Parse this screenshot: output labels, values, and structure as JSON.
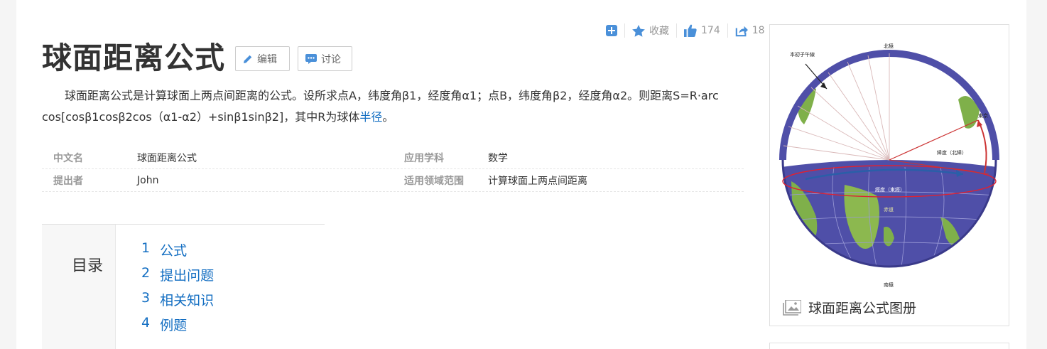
{
  "actions": {
    "add_icon": "plus-square-icon",
    "favorite_label": "收藏",
    "like_count": "174",
    "share_count": "18"
  },
  "title": "球面距离公式",
  "buttons": {
    "edit": "编辑",
    "discuss": "讨论"
  },
  "summary": {
    "text_before": "球面距离公式是计算球面上两点间距离的公式。设所求点A，纬度角β1，经度角α1；点B，纬度角β2，经度角α2。则距离S=R·arc cos[cosβ1cosβ2cos（α1-α2）+sinβ1sinβ2]，其中R为球体",
    "link": "半径",
    "text_after": "。"
  },
  "basic_info": [
    {
      "k1": "中文名",
      "v1": "球面距离公式",
      "k2": "应用学科",
      "v2": "数学"
    },
    {
      "k1": "提出者",
      "v1": "John",
      "k2": "适用领域范围",
      "v2": "计算球面上两点间距离"
    }
  ],
  "toc": {
    "heading": "目录",
    "items": [
      {
        "num": "1",
        "label": "公式"
      },
      {
        "num": "2",
        "label": "提出问题"
      },
      {
        "num": "3",
        "label": "相关知识"
      },
      {
        "num": "4",
        "label": "例题"
      }
    ]
  },
  "album": {
    "caption": "球面距离公式图册",
    "image_labels": {
      "north": "北極",
      "south": "南極",
      "meridian": "本初子午線",
      "latitude": "緯度（北緯）",
      "longitude": "經度（東經）",
      "equator": "赤道",
      "tokyo": "東京"
    }
  },
  "colors": {
    "link": "#136ec2",
    "accent": "#4a90d9"
  }
}
